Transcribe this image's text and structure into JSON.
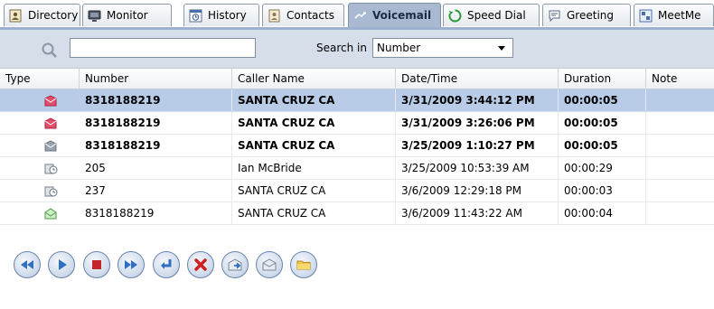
{
  "tabs": [
    {
      "label": "Directory",
      "icon": "directory-icon",
      "active": false
    },
    {
      "label": "Monitor",
      "icon": "monitor-icon",
      "active": false
    },
    {
      "label": "History",
      "icon": "history-icon",
      "active": false
    },
    {
      "label": "Contacts",
      "icon": "contacts-icon",
      "active": false
    },
    {
      "label": "Voicemail",
      "icon": "voicemail-icon",
      "active": true
    },
    {
      "label": "Speed Dial",
      "icon": "speed-dial-icon",
      "active": false
    },
    {
      "label": "Greeting",
      "icon": "greeting-icon",
      "active": false
    },
    {
      "label": "MeetMe",
      "icon": "meetme-icon",
      "active": false
    }
  ],
  "search": {
    "value": "",
    "search_in_label": "Search in",
    "search_in_value": "Number"
  },
  "table": {
    "columns": [
      "Type",
      "Number",
      "Caller Name",
      "Date/Time",
      "Duration",
      "Note"
    ],
    "rows": [
      {
        "type_icon": "new-voicemail-red-icon",
        "number": "8318188219",
        "caller": "SANTA CRUZ  CA",
        "datetime": "3/31/2009 3:44:12 PM",
        "duration": "00:00:05",
        "note": "",
        "bold": true,
        "selected": true
      },
      {
        "type_icon": "new-voicemail-red-icon",
        "number": "8318188219",
        "caller": "SANTA CRUZ  CA",
        "datetime": "3/31/2009 3:26:06 PM",
        "duration": "00:00:05",
        "note": "",
        "bold": true,
        "selected": false
      },
      {
        "type_icon": "new-voicemail-gray-icon",
        "number": "8318188219",
        "caller": "SANTA CRUZ  CA",
        "datetime": "3/25/2009 1:10:27 PM",
        "duration": "00:00:05",
        "note": "",
        "bold": true,
        "selected": false
      },
      {
        "type_icon": "saved-voicemail-icon",
        "number": "205",
        "caller": "Ian McBride",
        "datetime": "3/25/2009 10:53:39 AM",
        "duration": "00:00:29",
        "note": "",
        "bold": false,
        "selected": false
      },
      {
        "type_icon": "saved-voicemail-icon",
        "number": "237",
        "caller": "SANTA CRUZ  CA",
        "datetime": "3/6/2009 12:29:18 PM",
        "duration": "00:00:03",
        "note": "",
        "bold": false,
        "selected": false
      },
      {
        "type_icon": "read-voicemail-green-icon",
        "number": "8318188219",
        "caller": "SANTA CRUZ  CA",
        "datetime": "3/6/2009 11:43:22 AM",
        "duration": "00:00:04",
        "note": "",
        "bold": false,
        "selected": false
      }
    ]
  },
  "toolbar": {
    "buttons": [
      "rewind-icon",
      "play-icon",
      "stop-icon",
      "fast-forward-icon",
      "return-call-icon",
      "delete-icon",
      "forward-message-icon",
      "mark-read-icon",
      "save-to-folder-icon"
    ]
  },
  "colors": {
    "active_tab": "#a9b9d1",
    "search_bar": "#d6deea",
    "selected_row": "#b8cce8",
    "button_border": "#6a85b0"
  }
}
